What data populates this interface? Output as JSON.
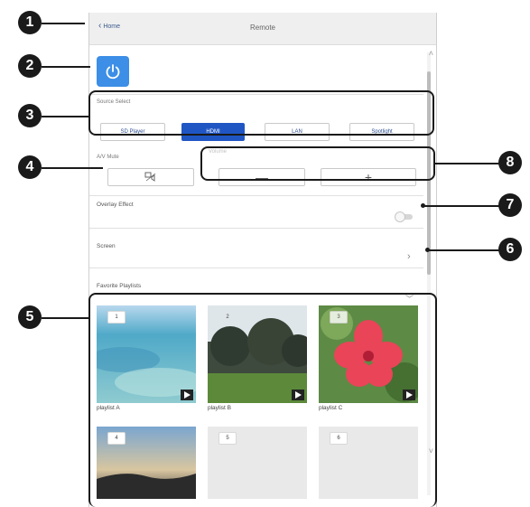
{
  "appbar": {
    "back_label": "Home",
    "title": "Remote"
  },
  "source_select": {
    "label": "Source Select",
    "options": [
      "SD Player",
      "HDMI",
      "LAN",
      "Spotlight"
    ],
    "selected": "HDMI"
  },
  "av_mute": {
    "label": "A/V Mute",
    "icon": "av-mute-icon"
  },
  "volume": {
    "label": "Volume",
    "minus": "—",
    "plus": "+"
  },
  "overlay": {
    "label": "Overlay Effect",
    "enabled": false
  },
  "screen": {
    "label": "Screen"
  },
  "favorites": {
    "label": "Favorite Playlists",
    "tiles": [
      {
        "num": "1",
        "label": "playlist A"
      },
      {
        "num": "2",
        "label": "playlist B"
      },
      {
        "num": "3",
        "label": "playlist C"
      },
      {
        "num": "4",
        "label": ""
      },
      {
        "num": "5",
        "label": ""
      },
      {
        "num": "6",
        "label": ""
      }
    ]
  },
  "callouts": [
    "1",
    "2",
    "3",
    "4",
    "5",
    "6",
    "7",
    "8"
  ],
  "colors": {
    "accent": "#1f56c4",
    "power": "#3c8ee6",
    "callout": "#1a1a1a"
  }
}
